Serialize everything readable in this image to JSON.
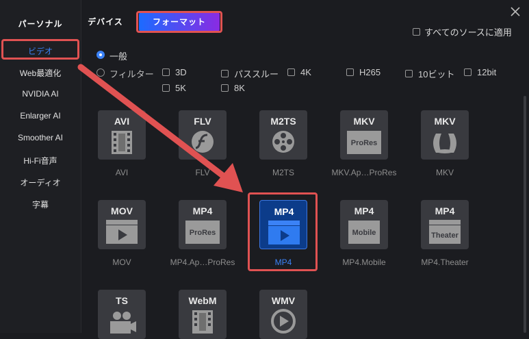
{
  "tabs": [
    "パーソナル",
    "デバイス",
    "フォーマット"
  ],
  "apply_all": "すべてのソースに適用",
  "sidebar": [
    "ビデオ",
    "Web最適化",
    "NVIDIA AI",
    "Enlarger AI",
    "Smoother AI",
    "Hi-Fi音声",
    "オーディオ",
    "字幕"
  ],
  "modes": {
    "general": "一般",
    "filter": "フィルター"
  },
  "filters": [
    "3D",
    "パススルー",
    "4K",
    "H265",
    "10ビット",
    "12bit",
    "5K",
    "8K"
  ],
  "formats": [
    {
      "badge": "AVI",
      "caption": "AVI",
      "icon": "film-strip-icon"
    },
    {
      "badge": "FLV",
      "caption": "FLV",
      "icon": "flash-icon"
    },
    {
      "badge": "M2TS",
      "caption": "M2TS",
      "icon": "film-reel-icon"
    },
    {
      "badge": "MKV",
      "caption": "MKV.Ap…ProRes",
      "icon": "prores-icon"
    },
    {
      "badge": "MKV",
      "caption": "MKV",
      "icon": "matroska-icon"
    },
    {
      "badge": "MOV",
      "caption": "MOV",
      "icon": "clapper-play-icon"
    },
    {
      "badge": "MP4",
      "caption": "MP4.Ap…ProRes",
      "icon": "prores-icon"
    },
    {
      "badge": "MP4",
      "caption": "MP4",
      "icon": "clapper-play-icon"
    },
    {
      "badge": "MP4",
      "caption": "MP4.Mobile",
      "icon": "mobile-icon"
    },
    {
      "badge": "MP4",
      "caption": "MP4.Theater",
      "icon": "theater-icon"
    },
    {
      "badge": "TS",
      "caption": "",
      "icon": "camera-icon"
    },
    {
      "badge": "WebM",
      "caption": "",
      "icon": "film-strip-icon"
    },
    {
      "badge": "WMV",
      "caption": "",
      "icon": "play-circle-icon"
    }
  ],
  "tile_texts": {
    "prores": "ProRes",
    "mobile": "Mobile",
    "theater": "Theater"
  },
  "colors": {
    "accent": "#3b82f6",
    "highlight": "#e05252",
    "selected_tile": "#0c3c8a"
  }
}
